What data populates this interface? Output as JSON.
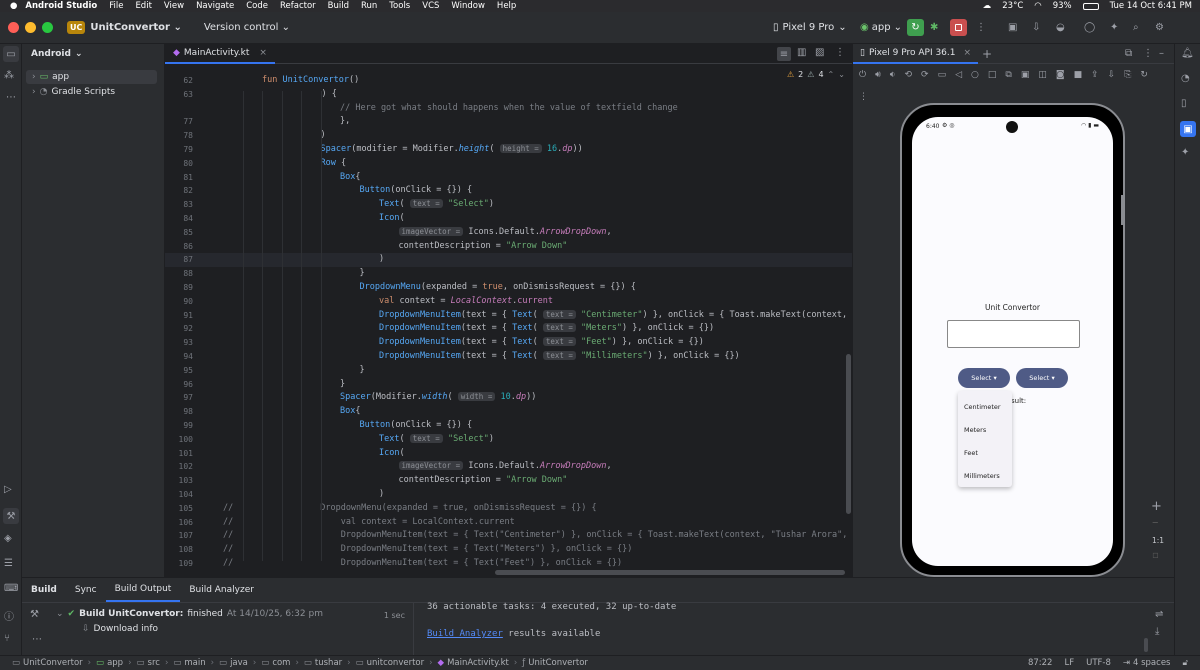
{
  "macbar": {
    "apple": "",
    "menus": [
      "Android Studio",
      "File",
      "Edit",
      "View",
      "Navigate",
      "Code",
      "Refactor",
      "Build",
      "Run",
      "Tools",
      "VCS",
      "Window",
      "Help"
    ],
    "weather": "23°C",
    "battery": "93%",
    "datetime": "Tue 14 Oct  6:41 PM"
  },
  "titlebar": {
    "project_badge": "UC",
    "project_name": "UnitConvertor",
    "vcs": "Version control",
    "device": "Pixel 9 Pro",
    "run_config": "app"
  },
  "project_panel": {
    "view": "Android",
    "items": [
      {
        "label": "app"
      },
      {
        "label": "Gradle Scripts"
      }
    ]
  },
  "editor": {
    "tab": "MainActivity.kt",
    "warnings": "2",
    "weak_warnings": "4",
    "lines": [
      {
        "n": "62",
        "html": "<span class='kw'>fun</span> <span class='fn'>UnitConvertor</span>()",
        "indent": 2
      },
      {
        "n": "63",
        "html": "    ) {",
        "indent": 4
      },
      {
        "n": "",
        "html": "<span class='cm'>// Here got what should happens when the value of textfield change</span>",
        "indent": 6
      },
      {
        "n": "77",
        "html": "},",
        "indent": 6
      },
      {
        "n": "78",
        "html": ")",
        "indent": 5
      },
      {
        "n": "79",
        "html": "<span class='fn'>Spacer</span>(modifier = Modifier.<span class='fn it'>height</span>( <span class='hint'>height =</span> <span class='num'>16</span>.<span class='prop it'>dp</span>))",
        "indent": 5
      },
      {
        "n": "80",
        "html": "<span class='fn'>Row</span> {",
        "indent": 5
      },
      {
        "n": "81",
        "html": "<span class='fn'>Box</span>{",
        "indent": 6
      },
      {
        "n": "82",
        "html": "<span class='fn'>Button</span>(onClick = {}) {",
        "indent": 7
      },
      {
        "n": "83",
        "html": "<span class='fn'>Text</span>( <span class='hint'>text =</span> <span class='str'>\"Select\"</span>)",
        "indent": 8
      },
      {
        "n": "84",
        "html": "<span class='fn'>Icon</span>(",
        "indent": 8
      },
      {
        "n": "85",
        "html": "<span class='hint'>imageVector =</span> Icons.Default.<span class='prop it'>ArrowDropDown</span>,",
        "indent": 9
      },
      {
        "n": "86",
        "html": "contentDescription = <span class='str'>\"Arrow Down\"</span>",
        "indent": 9
      },
      {
        "n": "87",
        "html": ")",
        "indent": 8
      },
      {
        "n": "88",
        "html": "}",
        "indent": 7
      },
      {
        "n": "89",
        "html": "<span class='fn'>DropdownMenu</span>(expanded = <span class='kw'>true</span>, onDismissRequest = {}) {",
        "indent": 7
      },
      {
        "n": "90",
        "html": "<span class='kw'>val</span> context = <span class='prop it'>LocalContext</span>.<span class='prop'>current</span>",
        "indent": 8
      },
      {
        "n": "91",
        "html": "<span class='fn'>DropdownMenuItem</span>(text = { <span class='fn'>Text</span>( <span class='hint'>text =</span> <span class='str'>\"Centimeter\"</span>) }, onClick = { Toast.makeText(context,  <span class='hint'>text =</span> <span class='str'>\"Tushar Arora</span>",
        "indent": 8
      },
      {
        "n": "92",
        "html": "<span class='fn'>DropdownMenuItem</span>(text = { <span class='fn'>Text</span>( <span class='hint'>text =</span> <span class='str'>\"Meters\"</span>) }, onClick = {})",
        "indent": 8
      },
      {
        "n": "93",
        "html": "<span class='fn'>DropdownMenuItem</span>(text = { <span class='fn'>Text</span>( <span class='hint'>text =</span> <span class='str'>\"Feet\"</span>) }, onClick = {})",
        "indent": 8
      },
      {
        "n": "94",
        "html": "<span class='fn'>DropdownMenuItem</span>(text = { <span class='fn'>Text</span>( <span class='hint'>text =</span> <span class='str'>\"Millimeters\"</span>) }, onClick = {})",
        "indent": 8
      },
      {
        "n": "95",
        "html": "}",
        "indent": 7
      },
      {
        "n": "96",
        "html": "}",
        "indent": 6
      },
      {
        "n": "97",
        "html": "<span class='fn'>Spacer</span>(Modifier.<span class='fn it'>width</span>( <span class='hint'>width =</span> <span class='num'>10</span>.<span class='prop it'>dp</span>))",
        "indent": 6
      },
      {
        "n": "98",
        "html": "<span class='fn'>Box</span>{",
        "indent": 6
      },
      {
        "n": "99",
        "html": "<span class='fn'>Button</span>(onClick = {}) {",
        "indent": 7
      },
      {
        "n": "100",
        "html": "<span class='fn'>Text</span>( <span class='hint'>text =</span> <span class='str'>\"Select\"</span>)",
        "indent": 8
      },
      {
        "n": "101",
        "html": "<span class='fn'>Icon</span>(",
        "indent": 8
      },
      {
        "n": "102",
        "html": "<span class='hint'>imageVector =</span> Icons.Default.<span class='prop it'>ArrowDropDown</span>,",
        "indent": 9
      },
      {
        "n": "103",
        "html": "contentDescription = <span class='str'>\"Arrow Down\"</span>",
        "indent": 9
      },
      {
        "n": "104",
        "html": ")",
        "indent": 8
      },
      {
        "n": "105",
        "html": "<span class='cm'>//                 DropdownMenu(expanded = true, onDismissRequest = {}) {</span>",
        "indent": 0
      },
      {
        "n": "106",
        "html": "<span class='cm'>//                     val context = LocalContext.current</span>",
        "indent": 0
      },
      {
        "n": "107",
        "html": "<span class='cm'>//                     DropdownMenuItem(text = { Text(\"Centimeter\") }, onClick = { Toast.makeText(context, \"Tushar Arora\", Toa</span>",
        "indent": 0
      },
      {
        "n": "108",
        "html": "<span class='cm'>//                     DropdownMenuItem(text = { Text(\"Meters\") }, onClick = {})</span>",
        "indent": 0
      },
      {
        "n": "109",
        "html": "<span class='cm'>//                     DropdownMenuItem(text = { Text(\"Feet\") }, onClick = {})</span>",
        "indent": 0
      },
      {
        "n": "110",
        "html": "<span class='cm'>//                     DropdownMenuItem(text = { Text(\"Millimeters\") }, onClick = {})</span>",
        "indent": 0
      }
    ]
  },
  "device_panel": {
    "tab": "Pixel 9 Pro API 36.1",
    "zoom": "1:1"
  },
  "phone": {
    "time": "6:40",
    "title": "Unit Convertor",
    "select1": "Select",
    "select2": "Select",
    "result_partial": "sult:",
    "menu": [
      "Centimeter",
      "Meters",
      "Feet",
      "Millimeters"
    ]
  },
  "bottom": {
    "tabs": [
      "Build",
      "Sync",
      "Build Output",
      "Build Analyzer"
    ],
    "tree_status": "Build UnitConvertor:",
    "tree_result": "finished",
    "tree_time": "At 14/10/25, 6:32 pm",
    "tree_duration": "1 sec",
    "tree_child": "Download info",
    "console_line1": "36 actionable tasks: 4 executed, 32 up-to-date",
    "console_link": "Build Analyzer",
    "console_rest": "results available"
  },
  "statusbar": {
    "crumbs": [
      "UnitConvertor",
      "app",
      "src",
      "main",
      "java",
      "com",
      "tushar",
      "unitconvertor",
      "MainActivity.kt",
      "UnitConvertor"
    ],
    "position": "87:22",
    "line_sep": "LF",
    "encoding": "UTF-8",
    "indent": "4 spaces"
  }
}
